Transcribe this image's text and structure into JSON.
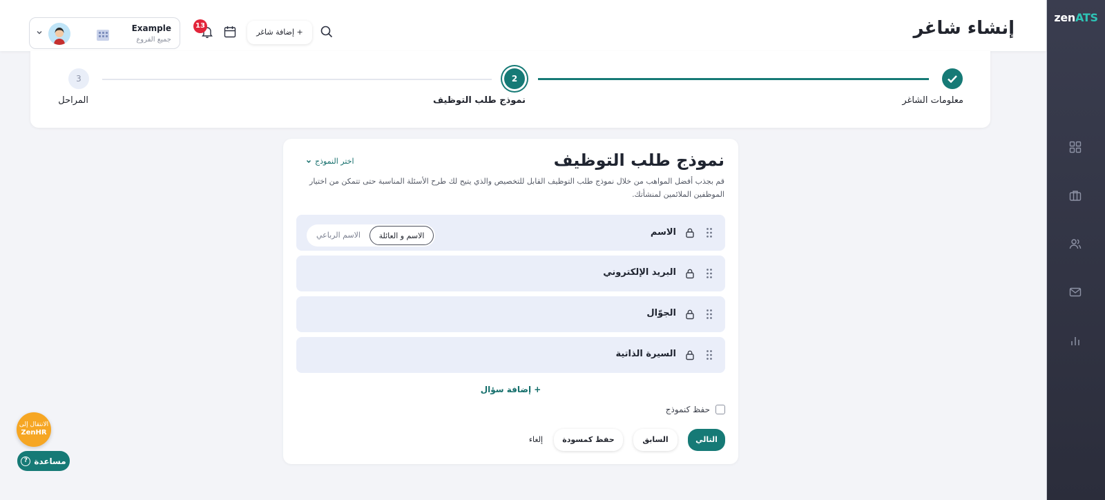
{
  "app": {
    "logo_main": "zen",
    "logo_accent": "ATS"
  },
  "header": {
    "page_title": "إنشاء شاغر",
    "add_vacancy_label": "+ إضافة شاغر",
    "notification_count": "13",
    "user": {
      "name": "Example",
      "subtitle": "جميع الفروع"
    }
  },
  "stepper": {
    "steps": [
      {
        "label": "معلومات الشاغر",
        "status": "completed",
        "number": ""
      },
      {
        "label": "نموذج طلب التوظيف",
        "status": "active",
        "number": "2"
      },
      {
        "label": "المراحل",
        "status": "pending",
        "number": "3"
      }
    ]
  },
  "form": {
    "title": "نموذج طلب التوظيف",
    "template_select_label": "اختر النموذج",
    "description": "قم بجذب أفضل المواهب من خلال نموذج طلب التوظيف القابل للتخصيص والذي يتيح لك طرح الأسئلة المناسبة حتى تتمكن من اختيار الموظفين الملائمين لمنشأتك.",
    "questions": [
      {
        "label": "الاسم"
      },
      {
        "label": "البريد الإلكتروني"
      },
      {
        "label": "الجوّال"
      },
      {
        "label": "السيرة الذاتية"
      }
    ],
    "name_format": {
      "options": [
        "الاسم و العائلة",
        "الاسم الرباعي"
      ],
      "selected": "الاسم و العائلة"
    },
    "add_question_label": "+ إضافة سؤال",
    "save_as_template_label": "حفظ كنموذج",
    "save_as_template_checked": false,
    "buttons": {
      "next": "التالي",
      "previous": "السابق",
      "save_draft": "حفظ كمسودة",
      "cancel": "إلغاء"
    }
  },
  "widgets": {
    "zenhr_line1": "الانتقال إلى",
    "zenhr_line2": "ZenHR",
    "help_label": "مساعدة",
    "help_icon": "?"
  },
  "colors": {
    "accent": "#167a76",
    "sidebar": "#2f3140",
    "badge": "#e2253a",
    "row_bg": "#eaeef9",
    "zenhr": "#f6a623"
  }
}
